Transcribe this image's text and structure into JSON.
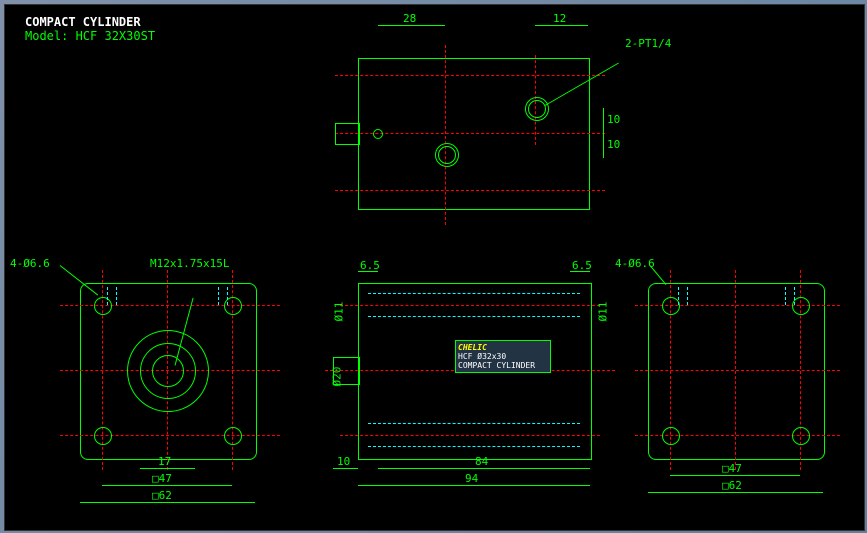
{
  "title": "COMPACT CYLINDER",
  "model": "Model: HCF 32X30ST",
  "dims": {
    "top_28": "28",
    "top_12": "12",
    "top_2pt14": "2-PT1/4",
    "top_10a": "10",
    "top_10b": "10",
    "left_466": "4-Ø6.6",
    "left_m12": "M12x1.75x15L",
    "left_17": "17",
    "left_47": "□47",
    "left_62": "□62",
    "mid_65a": "6.5",
    "mid_65b": "6.5",
    "mid_d11a": "Ø11",
    "mid_d11b": "Ø11",
    "mid_d20": "Ø20",
    "mid_10": "10",
    "mid_84": "84",
    "mid_94": "94",
    "right_466": "4-Ø6.6",
    "right_47": "□47",
    "right_62": "□62"
  },
  "nameplate": {
    "brand": "CHELIC",
    "line1": "HCF Ø32x30",
    "line2": "COMPACT CYLINDER"
  }
}
